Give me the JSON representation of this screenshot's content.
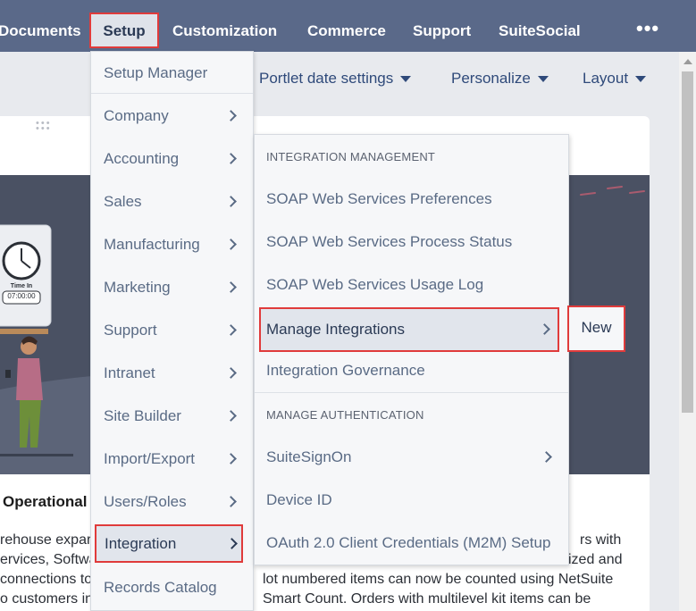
{
  "navbar": {
    "items": [
      "Documents",
      "Setup",
      "Customization",
      "Commerce",
      "Support",
      "SuiteSocial"
    ],
    "more_label": "•••"
  },
  "toolbar": {
    "portlet_date_settings": "Portlet date settings",
    "personalize": "Personalize",
    "layout": "Layout"
  },
  "setup_menu": {
    "items": [
      "Setup Manager",
      "Company",
      "Accounting",
      "Sales",
      "Manufacturing",
      "Marketing",
      "Support",
      "Intranet",
      "Site Builder",
      "Import/Export",
      "Users/Roles",
      "Integration",
      "Records Catalog"
    ]
  },
  "integration_menu": {
    "header_1": "INTEGRATION MANAGEMENT",
    "items_1": [
      "SOAP Web Services Preferences",
      "SOAP Web Services Process Status",
      "SOAP Web Services Usage Log",
      "Manage Integrations",
      "Integration Governance"
    ],
    "header_2": "MANAGE AUTHENTICATION",
    "items_2": [
      "SuiteSignOn",
      "Device ID",
      "OAuth 2.0 Client Credentials (M2M) Setup"
    ]
  },
  "manage_integrations_menu": {
    "new_label": "New"
  },
  "portlet": {
    "heading": "Operational",
    "clock_label": "Time In",
    "clock_time": "07:00:00",
    "left_lines": [
      "rehouse expar",
      "ervices, Softwa",
      "connections to",
      "o customers in"
    ],
    "right_lines": [
      "rs with",
      "ized and",
      "lot numbered items can now be counted using NetSuite",
      "Smart Count. Orders with multilevel kit items can be"
    ]
  },
  "colors": {
    "navbar": "#5a6989",
    "highlight_border": "#e03b3b",
    "menu_text": "#5a6b85",
    "banner": "#4a5163"
  }
}
